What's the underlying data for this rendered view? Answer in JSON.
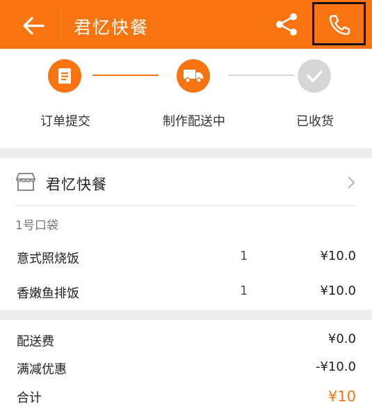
{
  "header": {
    "title": "君忆快餐",
    "back_icon": "arrow-left-icon",
    "share_icon": "share-icon",
    "call_icon": "phone-icon",
    "bg_color": "#f87410"
  },
  "progress": {
    "steps": [
      {
        "label": "订单提交",
        "icon": "document-icon",
        "state": "done"
      },
      {
        "label": "制作配送中",
        "icon": "truck-icon",
        "state": "active"
      },
      {
        "label": "已收货",
        "icon": "check-icon",
        "state": "pending"
      }
    ],
    "active_color": "#f87410",
    "pending_color": "#d6d6d6"
  },
  "shop": {
    "name": "君忆快餐",
    "icon": "store-icon"
  },
  "bag": "1号口袋",
  "items": [
    {
      "name": "意式照烧饭",
      "qty": "1",
      "price": "¥10.0"
    },
    {
      "name": "香嫩鱼排饭",
      "qty": "1",
      "price": "¥10.0"
    }
  ],
  "fees": [
    {
      "label": "配送费",
      "value": "¥0.0"
    },
    {
      "label": "满减优惠",
      "value": "-¥10.0"
    }
  ],
  "total": {
    "label": "合计",
    "value": "¥10"
  }
}
